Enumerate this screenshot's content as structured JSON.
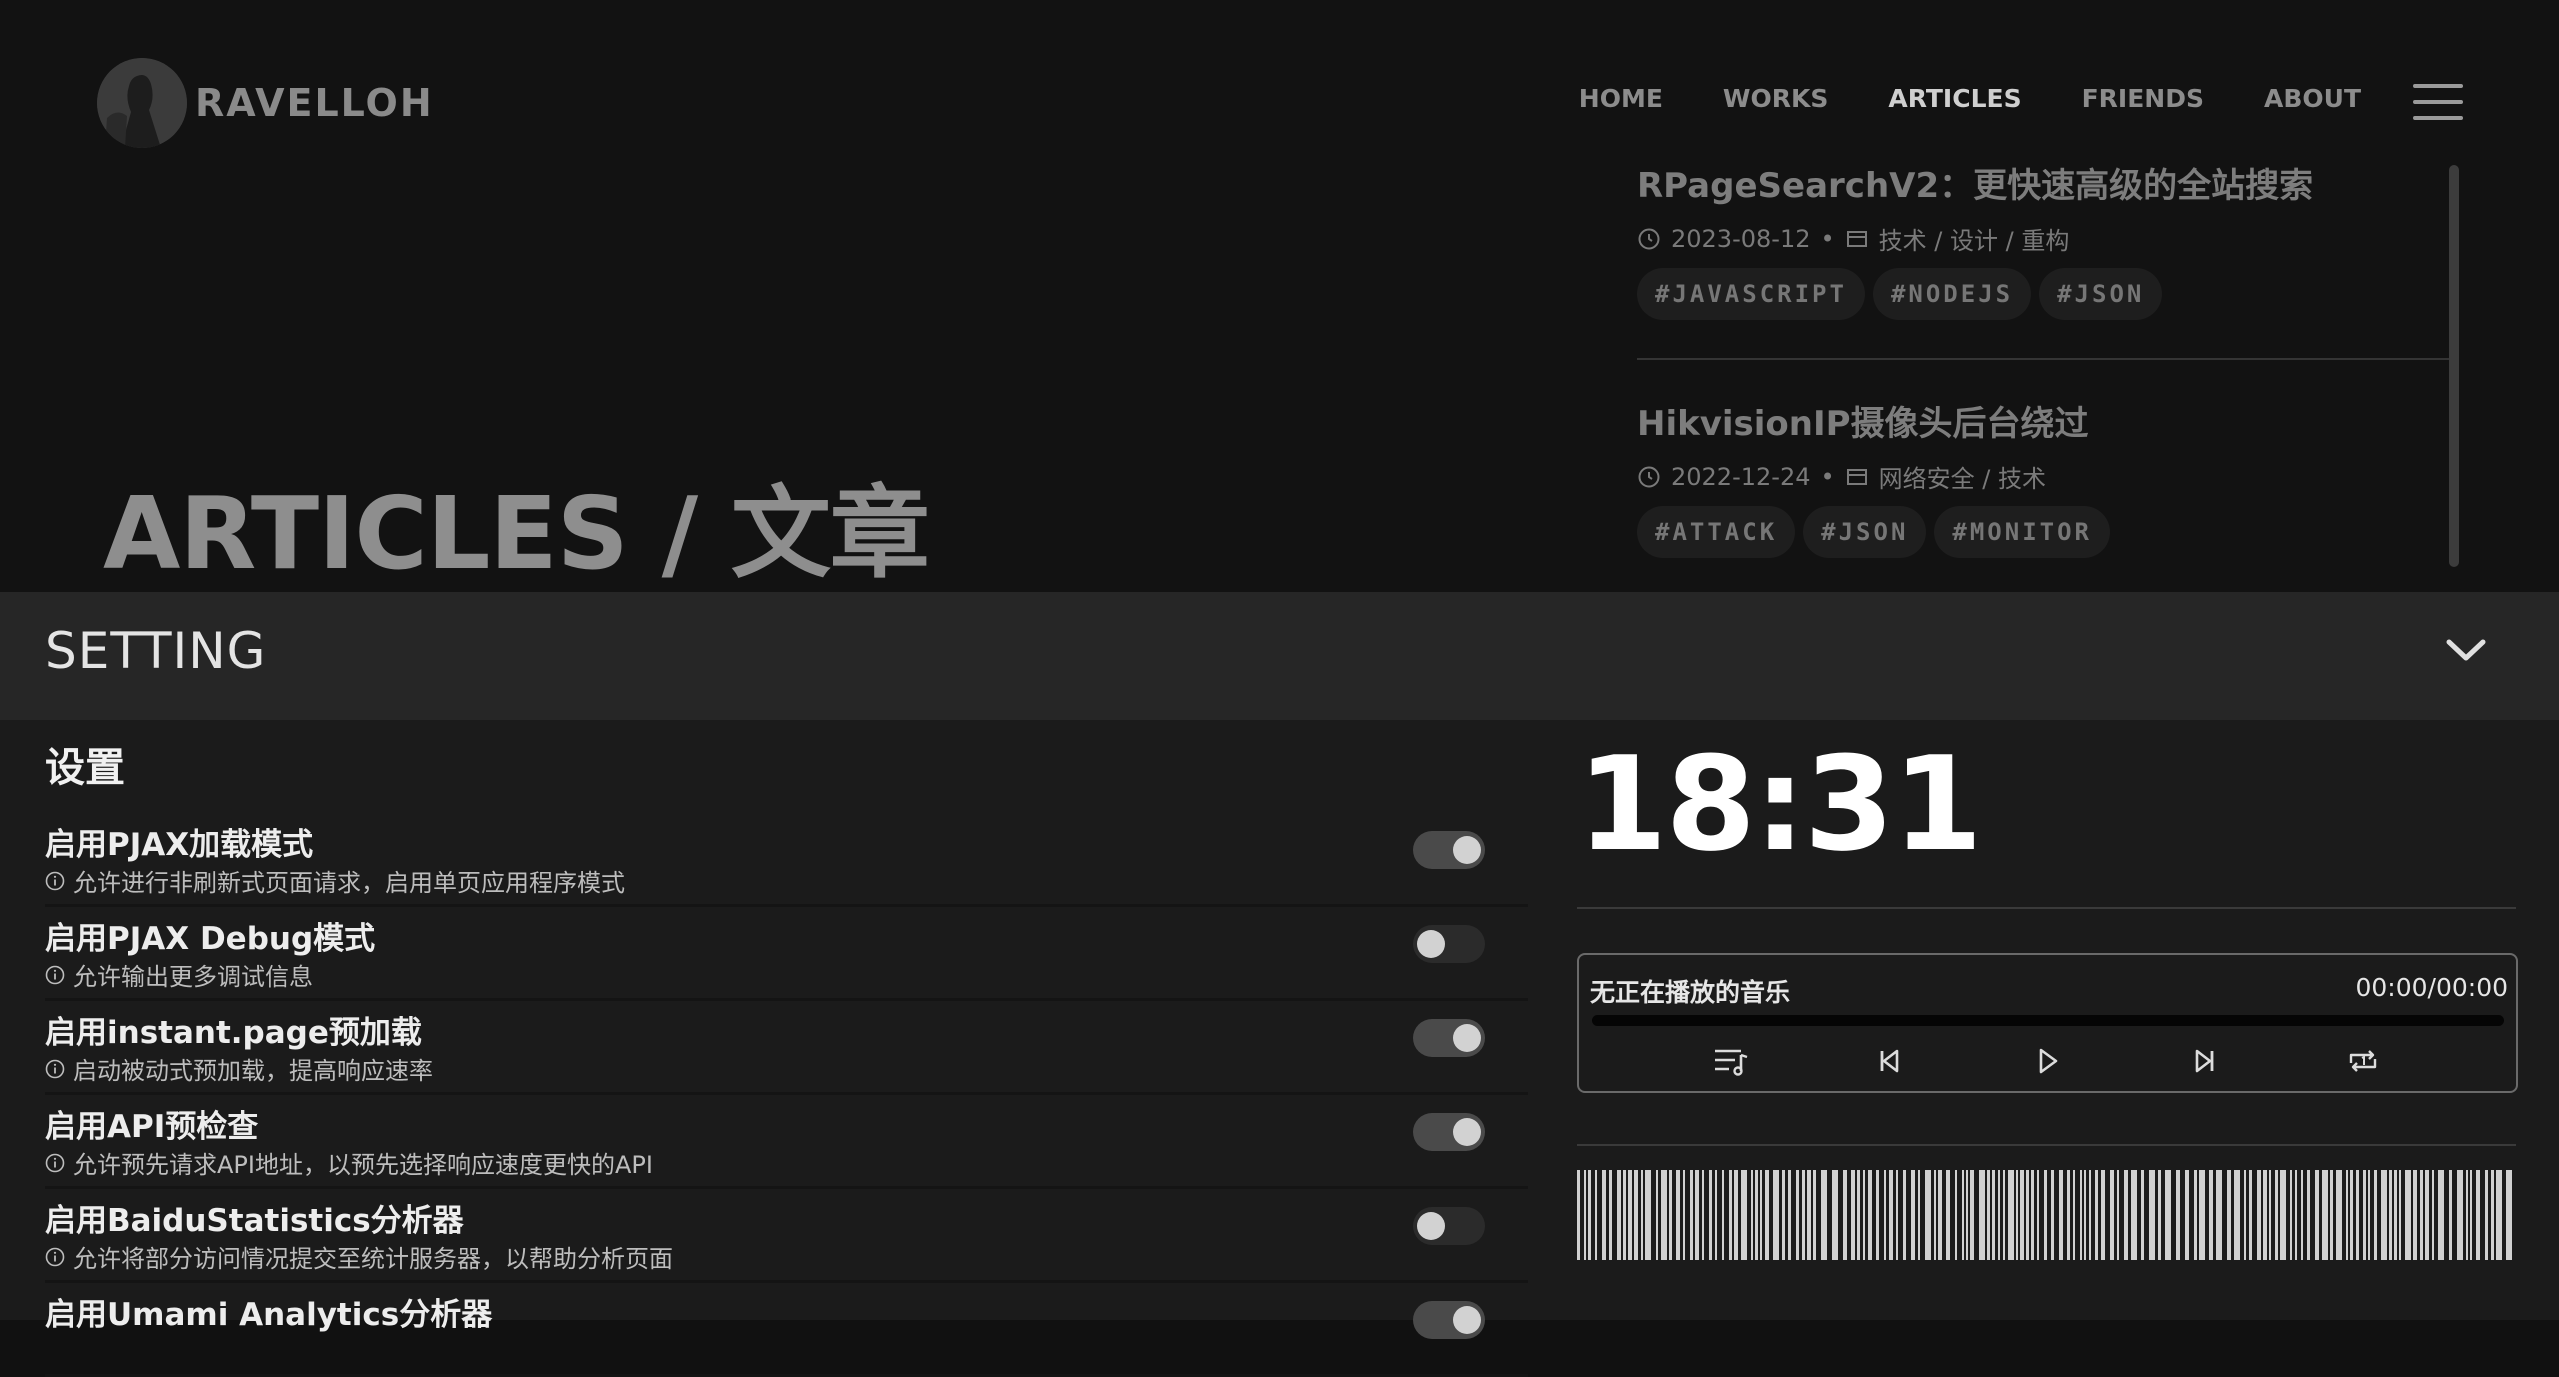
{
  "header": {
    "brand": "RAVELLOH",
    "nav": [
      "HOME",
      "WORKS",
      "ARTICLES",
      "FRIENDS",
      "ABOUT"
    ],
    "active_nav": "ARTICLES"
  },
  "hero": {
    "title": "ARTICLES / 文章"
  },
  "articles": [
    {
      "title": "RPageSearchV2：更快速高级的全站搜索",
      "date": "2023-08-12",
      "categories": "技术 / 设计 / 重构",
      "tags": [
        "#JAVASCRIPT",
        "#NODEJS",
        "#JSON"
      ]
    },
    {
      "title": "HikvisionIP摄像头后台绕过",
      "date": "2022-12-24",
      "categories": "网络安全 / 技术",
      "tags": [
        "#ATTACK",
        "#JSON",
        "#MONITOR"
      ]
    }
  ],
  "setting": {
    "bar_title": "SETTING",
    "section_title": "设置",
    "items": [
      {
        "name": "启用PJAX加载模式",
        "desc": "允许进行非刷新式页面请求，启用单页应用程序模式",
        "enabled": true
      },
      {
        "name": "启用PJAX Debug模式",
        "desc": "允许输出更多调试信息",
        "enabled": false
      },
      {
        "name": "启用instant.page预加载",
        "desc": "启动被动式预加载，提高响应速率",
        "enabled": true
      },
      {
        "name": "启用API预检查",
        "desc": "允许预先请求API地址，以预先选择响应速度更快的API",
        "enabled": true
      },
      {
        "name": "启用BaiduStatistics分析器",
        "desc": "允许将部分访问情况提交至统计服务器，以帮助分析页面",
        "enabled": false
      },
      {
        "name": "启用Umami Analytics分析器",
        "desc": "",
        "enabled": true
      }
    ]
  },
  "clock": {
    "time": "18:31"
  },
  "player": {
    "song": "无正在播放的音乐",
    "time": "00:00/00:00",
    "progress": 0,
    "controls": [
      "playlist-icon",
      "previous-icon",
      "play-icon",
      "next-icon",
      "repeat-one-icon"
    ]
  }
}
